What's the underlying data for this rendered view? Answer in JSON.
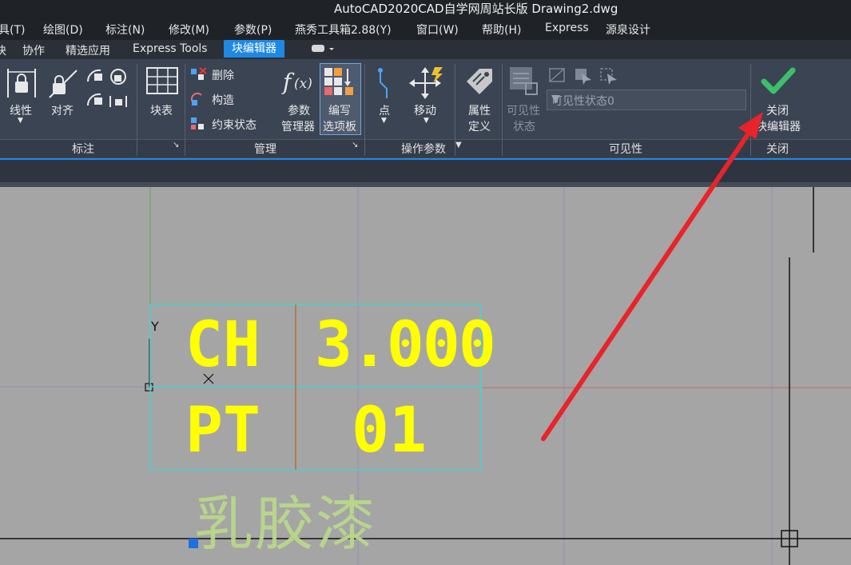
{
  "window": {
    "title": "AutoCAD2020CAD自学网周站长版   Drawing2.dwg"
  },
  "menu": [
    "具(T)",
    "绘图(D)",
    "标注(N)",
    "修改(M)",
    "参数(P)",
    "燕秀工具箱2.88(Y)",
    "窗口(W)",
    "帮助(H)",
    "Express",
    "源泉设计"
  ],
  "tabs": [
    "块",
    "协作",
    "精选应用",
    "Express Tools",
    "块编辑器"
  ],
  "active_tab": "块编辑器",
  "ribbon": {
    "dim_panel": {
      "title": "标注",
      "linear": "线性",
      "align": "对齐"
    },
    "table_button": "块表",
    "manage_panel": {
      "title": "管理",
      "delete": "删除",
      "construct": "构造",
      "constraint_status": "约束状态",
      "param_manager_1": "参数",
      "param_manager_2": "管理器",
      "authoring_1": "编写",
      "authoring_2": "选项板"
    },
    "action_panel": {
      "title": "操作参数",
      "point": "点",
      "move": "移动",
      "attribute_1": "属性",
      "attribute_2": "定义"
    },
    "visibility_panel": {
      "title": "可见性",
      "vis_state_1": "可见性",
      "vis_state_2": "状态",
      "dropdown_value": "可见性状态0"
    },
    "close_panel": {
      "title": "关闭",
      "close_1": "关闭",
      "close_2": "块编辑器"
    }
  },
  "drawing": {
    "cells": {
      "r1c1": "CH",
      "r1c2": "3.000",
      "r2c1": "PT",
      "r2c2": "01"
    },
    "axis_y": "Y",
    "label_cn": "乳胶漆"
  },
  "colors": {
    "accent": "#1e88e5",
    "ribbon_bg": "#3b4453",
    "text_yellow": "#ffff00",
    "arrow_red": "#e8242a",
    "check_green": "#3cc06b"
  }
}
